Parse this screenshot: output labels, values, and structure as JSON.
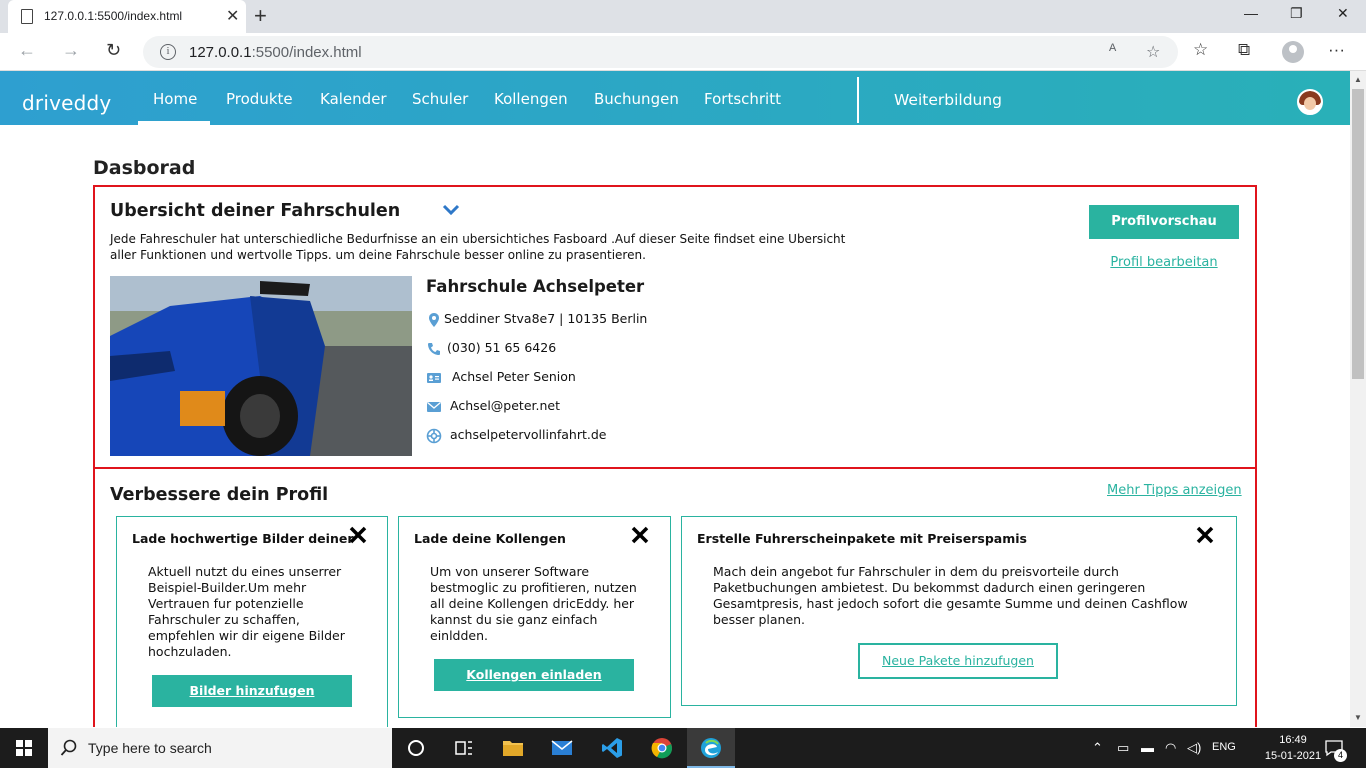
{
  "browser": {
    "tab_title": "127.0.0.1:5500/index.html",
    "url_host": "127.0.0.1",
    "url_rest": ":5500/index.html"
  },
  "nav": {
    "brand": "driveddy",
    "items": [
      {
        "label": "Home",
        "active": true
      },
      {
        "label": "Produkte"
      },
      {
        "label": "Kalender"
      },
      {
        "label": "Schuler"
      },
      {
        "label": "Kollengen"
      },
      {
        "label": "Buchungen"
      },
      {
        "label": "Fortschritt"
      }
    ],
    "secondary": "Weiterbildung"
  },
  "page_title": "Dasborad",
  "overview": {
    "title": "Ubersicht deiner Fahrschulen",
    "description": "Jede Fahreschuler hat unterschiedliche Bedurfnisse an ein ubersichtiches Fasboard .Auf dieser Seite findset eine Ubersicht aller Funktionen und wertvolle Tipps. um deine Fahrschule besser online zu prasentieren.",
    "preview_button": "Profilvorschau",
    "edit_link": "Profil bearbeitan",
    "school": {
      "name": "Fahrschule Achselpeter",
      "address": "Seddiner Stva8e7 | 10135 Berlin",
      "phone": "(030) 51 65 6426",
      "owner": "Achsel Peter Senion",
      "email": "Achsel@peter.net",
      "website": "achselpetervollinfahrt.de"
    }
  },
  "improve": {
    "title": "Verbessere dein Profil",
    "more_link": "Mehr Tipps anzeigen",
    "tips": [
      {
        "title": "Lade hochwertige Bilder deiner",
        "body": [
          "Aktuell nutzt du eines unserrer",
          "Beispiel-Builder.Um mehr",
          "Vertrauen fur potenzielle",
          "Fahrschuler zu schaffen,",
          "empfehlen wir dir eigene Bilder",
          "hochzuladen."
        ],
        "button": "Bilder hinzufugen"
      },
      {
        "title": "Lade deine Kollengen",
        "body": [
          "Um von unserer Software",
          "bestmoglic zu profitieren, nutzen",
          "all deine Kollengen dricEddy. her",
          "kannst du sie ganz einfach",
          "einldden."
        ],
        "button": "Kollengen einladen"
      },
      {
        "title": "Erstelle Fuhrerscheinpakete mit Preiserspamis",
        "body": [
          "Mach dein angebot fur Fahrschuler in dem du preisvorteile durch",
          "Paketbuchungen ambietest. Du bekommst dadurch einen geringeren",
          "Gesamtpresis, hast jedoch sofort die gesamte Summe und deinen Cashflow",
          "besser planen."
        ],
        "button": "Neue Pakete hinzufugen"
      }
    ]
  },
  "taskbar": {
    "search_placeholder": "Type here to search",
    "language": "ENG",
    "time": "16:49",
    "date": "15-01-2021",
    "notifications": "4"
  },
  "colors": {
    "accent": "#2ab3a0",
    "nav_start": "#2e9fd0",
    "nav_end": "#29b0b8",
    "highlight_border": "#e0141c"
  }
}
